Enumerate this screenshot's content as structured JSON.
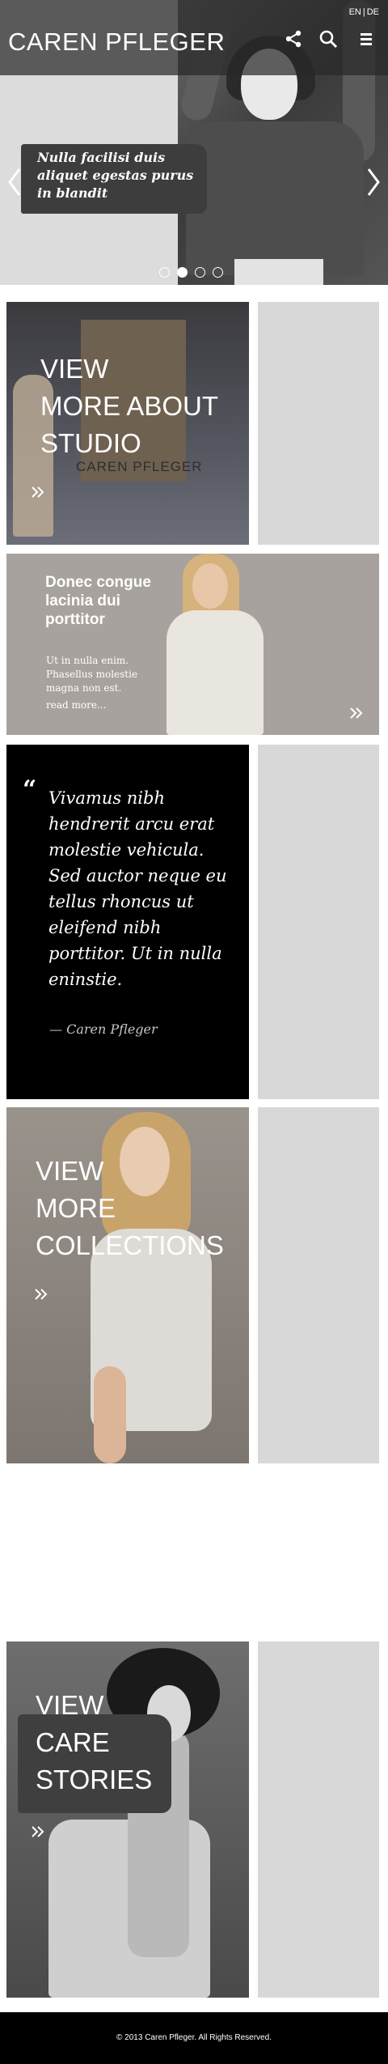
{
  "header": {
    "logo": "CAREN PFLEGER",
    "languages": [
      "EN",
      "DE"
    ],
    "language_separator": "|",
    "icons": [
      "share-icon",
      "search-icon",
      "menu-icon"
    ]
  },
  "hero": {
    "caption": "Nulla facilisi duis aliquet egestas purus in blandit",
    "slides_total": 4,
    "active_slide": 2,
    "controls": [
      "chevron-left-icon",
      "chevron-right-icon"
    ]
  },
  "tiles": {
    "studio": {
      "line1": "VIEW",
      "line2": "MORE ABOUT",
      "line3": "STUDIO",
      "shop_sign": "CAREN PFLEGER"
    },
    "donec": {
      "heading": "Donec congue lacinia dui porttitor",
      "body": "Ut in nulla enim. Phasellus molestie magna non est.",
      "read_more": "read more..."
    },
    "quote": {
      "mark": "“",
      "text": "Vivamus nibh hendrerit arcu erat molestie vehicula. Sed auctor neque eu tellus rhoncus ut eleifend nibh porttitor. Ut in nulla eninstie.",
      "author": "— Caren Pfleger"
    },
    "collections": {
      "line1": "VIEW",
      "line2": "MORE",
      "line3": "COLLECTIONS"
    },
    "care": {
      "line1": "VIEW",
      "line2": "CARE",
      "line3": "STORIES"
    }
  },
  "footer": {
    "copyright": "© 2013 Caren Pfleger. All Rights Reserved."
  },
  "colors": {
    "header_bar": "#2d2d2d",
    "tile_grey": "#d8d8d8",
    "quote_bg": "#000000",
    "footer_bg": "#000000"
  }
}
